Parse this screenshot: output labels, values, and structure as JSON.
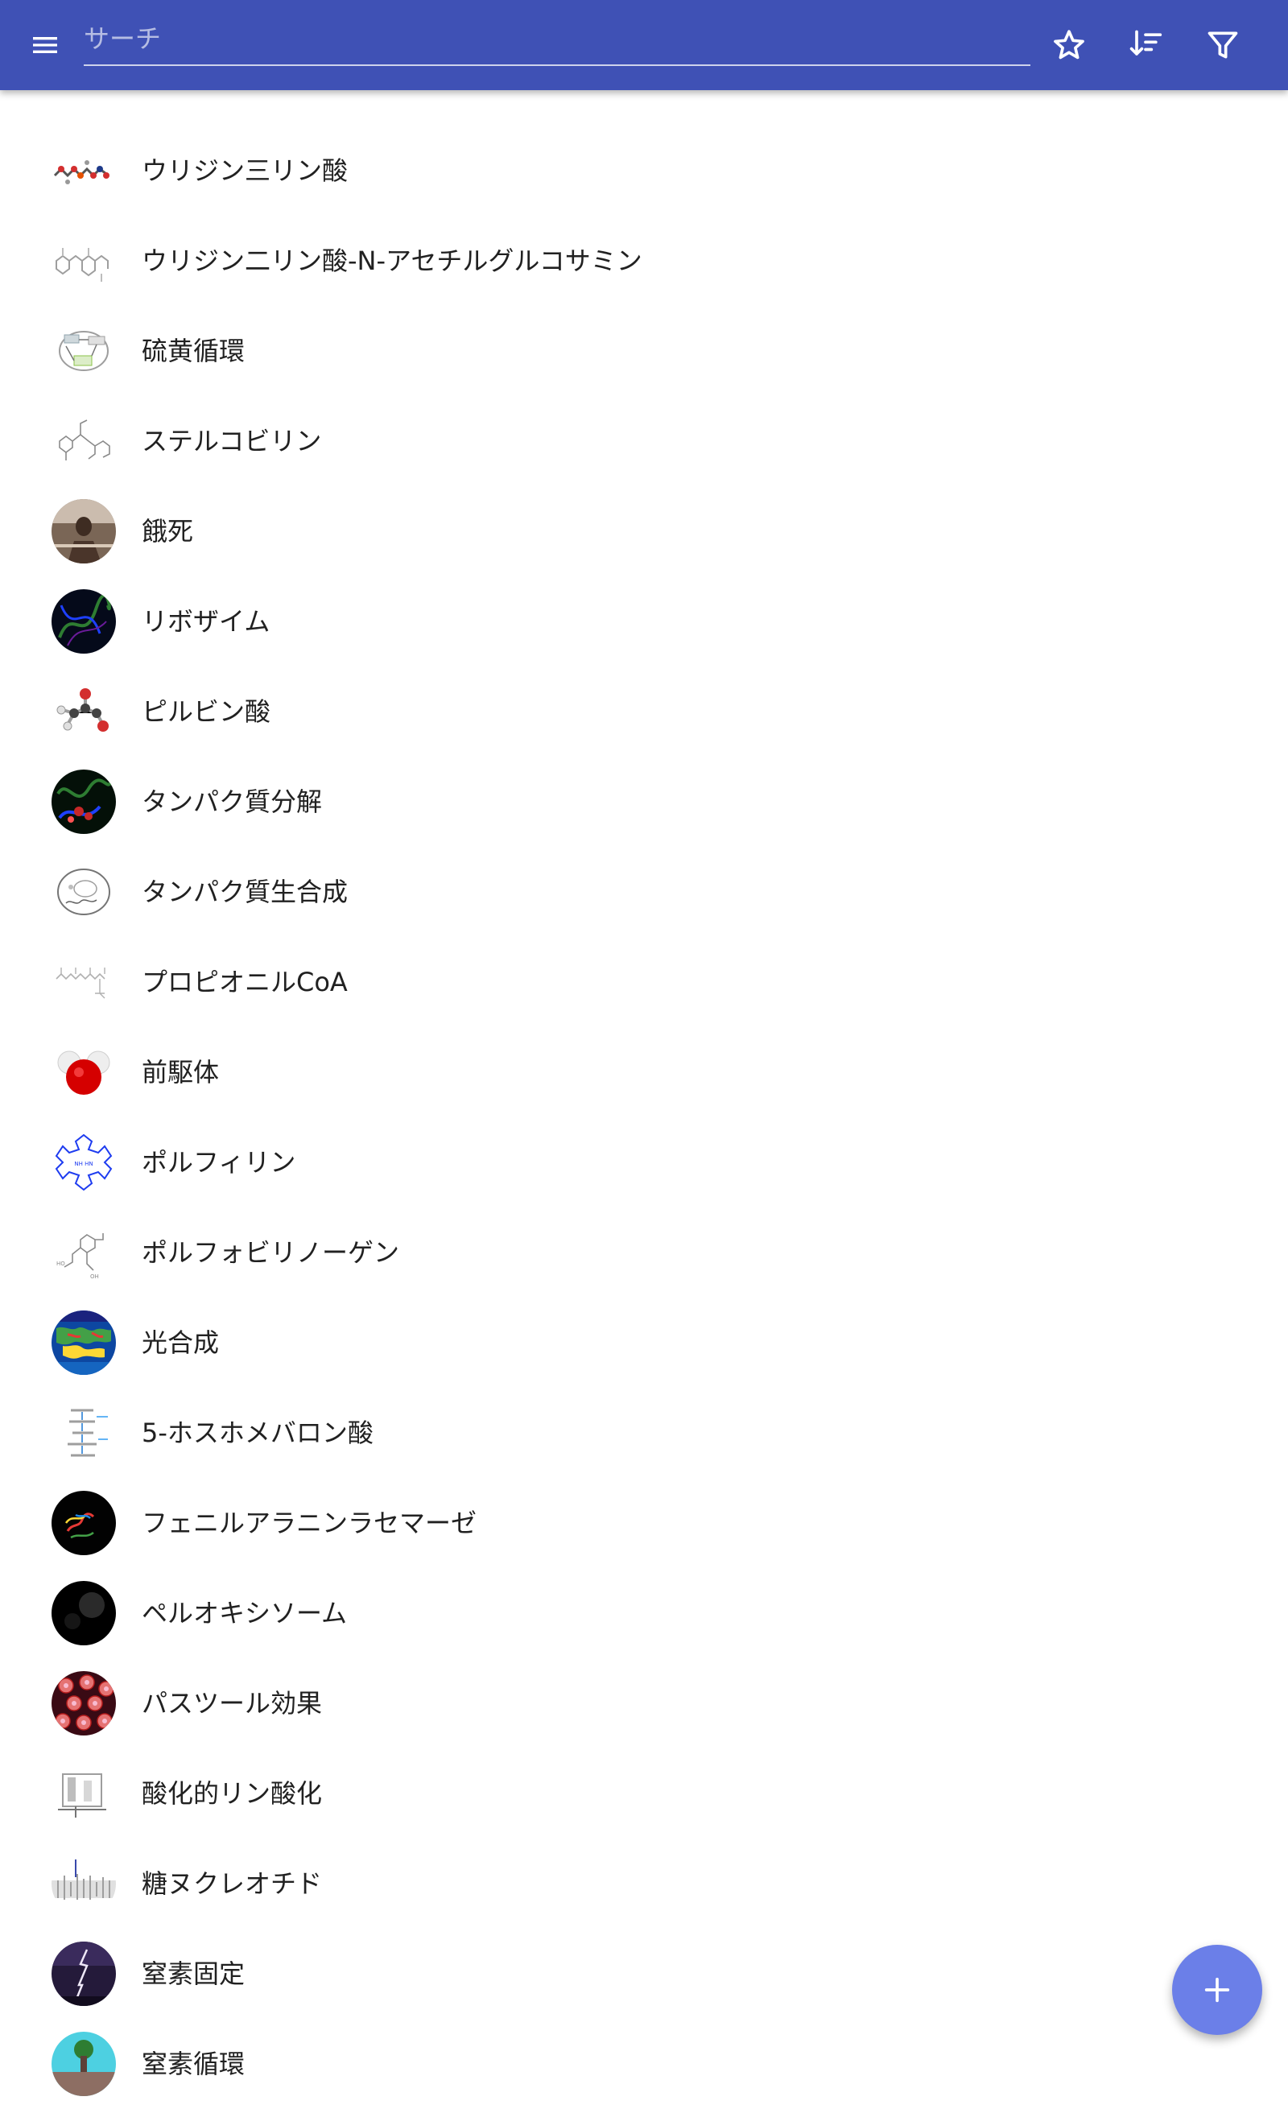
{
  "appbar": {
    "background": "#3f51b5",
    "menu_icon": "menu-icon",
    "search_placeholder": "サーチ",
    "search_value": "",
    "actions": [
      "star-icon",
      "sort-icon",
      "filter-icon"
    ]
  },
  "items": [
    {
      "label": "ウリジン三リン酸",
      "icon": "molecule-skeleton-icon"
    },
    {
      "label": "ウリジン二リン酸-N-アセチルグルコサミン",
      "icon": "molecule-skeleton-icon"
    },
    {
      "label": "硫黄循環",
      "icon": "cycle-diagram-icon"
    },
    {
      "label": "ステルコビリン",
      "icon": "structure-formula-icon"
    },
    {
      "label": "餓死",
      "icon": "photo-icon"
    },
    {
      "label": "リボザイム",
      "icon": "ribbon-structure-icon"
    },
    {
      "label": "ピルビン酸",
      "icon": "ball-and-stick-icon"
    },
    {
      "label": "タンパク質分解",
      "icon": "protein-structure-icon"
    },
    {
      "label": "タンパク質生合成",
      "icon": "cell-diagram-icon"
    },
    {
      "label": "プロピオニルCoA",
      "icon": "structure-formula-icon"
    },
    {
      "label": "前駆体",
      "icon": "space-filling-molecule-icon"
    },
    {
      "label": "ポルフィリン",
      "icon": "porphyrin-ring-icon"
    },
    {
      "label": "ポルフォビリノーゲン",
      "icon": "structure-formula-icon"
    },
    {
      "label": "光合成",
      "icon": "global-map-icon"
    },
    {
      "label": "5-ホスホメバロン酸",
      "icon": "pathway-diagram-icon"
    },
    {
      "label": "フェニルアラニンラセマーゼ",
      "icon": "protein-structure-icon"
    },
    {
      "label": "ペルオキシソーム",
      "icon": "micrograph-icon"
    },
    {
      "label": "パスツール効果",
      "icon": "blood-cells-icon"
    },
    {
      "label": "酸化的リン酸化",
      "icon": "pathway-diagram-icon"
    },
    {
      "label": "糖ヌクレオチド",
      "icon": "molecule-skeleton-icon"
    },
    {
      "label": "窒素固定",
      "icon": "lightning-photo-icon"
    },
    {
      "label": "窒素循環",
      "icon": "cycle-diagram-icon"
    }
  ],
  "fab": {
    "icon": "plus-icon",
    "color": "#6b7fe8"
  }
}
